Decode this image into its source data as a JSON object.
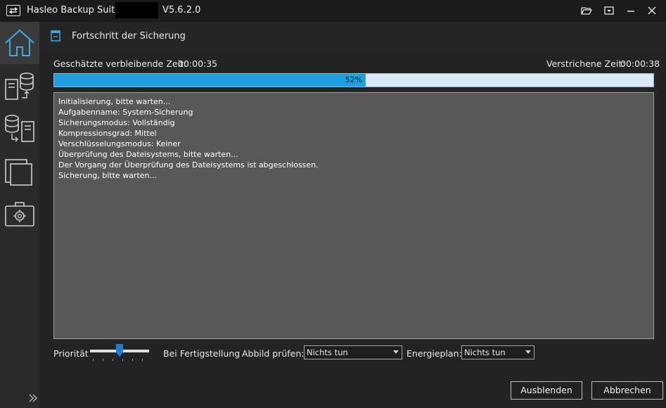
{
  "titlebar": {
    "app_name": "Hasleo Backup Suite",
    "version": "V5.6.2.0",
    "buttons": [
      "open-folder-icon",
      "menu-icon",
      "minimize-icon",
      "close-icon"
    ]
  },
  "sidebar": {
    "items": [
      {
        "name": "home",
        "icon": "home-icon",
        "active": true
      },
      {
        "name": "backup",
        "icon": "backup-icon"
      },
      {
        "name": "restore",
        "icon": "restore-icon"
      },
      {
        "name": "clone",
        "icon": "clone-icon"
      },
      {
        "name": "tools",
        "icon": "tools-icon"
      }
    ],
    "expand_icon": "double-chevron-right-icon"
  },
  "header": {
    "title": "Fortschritt der Sicherung"
  },
  "progress": {
    "remaining_label": "Geschätzte verbleibende Zeit:",
    "remaining_value": "00:00:35",
    "elapsed_label": "Verstrichene Zeit:",
    "elapsed_value": "00:00:38",
    "percent": 52,
    "percent_text": "52%"
  },
  "log": {
    "lines": [
      "Initialisierung, bitte warten...",
      "Aufgabenname: System-Sicherung",
      "Sicherungsmodus: Vollständig",
      "Kompressionsgrad: Mittel",
      "Verschlüsselungsmodus: Keiner",
      "Überprüfung des Dateisystems, bitte warten...",
      "Der Vorgang der Überprüfung des Dateisystems ist abgeschlossen.",
      "Sicherung, bitte warten..."
    ]
  },
  "options": {
    "priority_label": "Priorität",
    "priority_level": 0.5,
    "on_complete_label": "Bei Fertigstellung",
    "verify_label": "Abbild prüfen:",
    "verify_value": "Nichts tun",
    "power_label": "Energieplan:",
    "power_value": "Nichts tun"
  },
  "actions": {
    "hide": "Ausblenden",
    "cancel": "Abbrechen"
  },
  "colors": {
    "accent": "#1ba1e2",
    "progress_bg": "#d9e9f7",
    "log_bg": "#585858"
  }
}
